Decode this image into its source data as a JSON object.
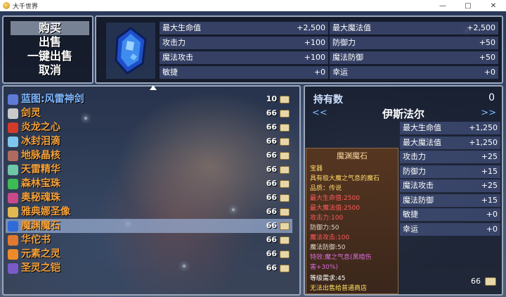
{
  "window": {
    "title": "大千世界",
    "controls": [
      "—",
      "□",
      "✕"
    ]
  },
  "commands": [
    "购买",
    "出售",
    "一键出售",
    "取消"
  ],
  "detail_stats": [
    {
      "label": "最大生命值",
      "value": "+2,500"
    },
    {
      "label": "最大魔法值",
      "value": "+2,500"
    },
    {
      "label": "攻击力",
      "value": "+100"
    },
    {
      "label": "防御力",
      "value": "+50"
    },
    {
      "label": "魔法攻击",
      "value": "+100"
    },
    {
      "label": "魔法防御",
      "value": "+50"
    },
    {
      "label": "敏捷",
      "value": "+0"
    },
    {
      "label": "幸运",
      "value": "+0"
    }
  ],
  "items": [
    {
      "name": "蓝图:风雷神剑",
      "count": "10",
      "color": "#5f7bd8",
      "text_color": "#7fb8ff"
    },
    {
      "name": "剑灵",
      "count": "66",
      "color": "#c9c9c9",
      "text_color": "#f5a13a"
    },
    {
      "name": "炎龙之心",
      "count": "66",
      "color": "#d23a2a",
      "text_color": "#f5a13a"
    },
    {
      "name": "冰封泪滴",
      "count": "66",
      "color": "#7ec6f0",
      "text_color": "#f5a13a"
    },
    {
      "name": "地脉晶核",
      "count": "66",
      "color": "#b06a60",
      "text_color": "#f5a13a"
    },
    {
      "name": "天雷精华",
      "count": "66",
      "color": "#6fc7a8",
      "text_color": "#f5a13a"
    },
    {
      "name": "森林宝珠",
      "count": "66",
      "color": "#3dbb55",
      "text_color": "#f5a13a"
    },
    {
      "name": "奥秘魂珠",
      "count": "66",
      "color": "#c94a8a",
      "text_color": "#f5a13a"
    },
    {
      "name": "雅典娜圣像",
      "count": "66",
      "color": "#e0b850",
      "text_color": "#f5a13a"
    },
    {
      "name": "魔渊魔石",
      "count": "66",
      "color": "#2f6bd8",
      "text_color": "#f5a13a"
    },
    {
      "name": "华佗书",
      "count": "66",
      "color": "#e07a30",
      "text_color": "#f5a13a"
    },
    {
      "name": "元素之灵",
      "count": "66",
      "color": "#ee8a2a",
      "text_color": "#f5a13a"
    },
    {
      "name": "圣灵之铠",
      "count": "66",
      "color": "#7a5ac8",
      "text_color": "#f5a13a"
    }
  ],
  "selected_index": 9,
  "side": {
    "owned_label": "持有数",
    "owned_value": "0",
    "prev": "<<",
    "next": ">>",
    "character": "伊斯法尔",
    "stats": [
      {
        "label": "最大生命值",
        "value": "+1,250"
      },
      {
        "label": "最大魔法值",
        "value": "+1,250"
      },
      {
        "label": "攻击力",
        "value": "+25"
      },
      {
        "label": "防御力",
        "value": "+15"
      },
      {
        "label": "魔法攻击",
        "value": "+25"
      },
      {
        "label": "魔法防御",
        "value": "+15"
      },
      {
        "label": "敏捷",
        "value": "+0"
      },
      {
        "label": "幸运",
        "value": "+0"
      }
    ],
    "price": "66"
  },
  "card": {
    "title": "魔渊魔石",
    "category": "宝器",
    "desc": "具有极大魔之气息的魔石",
    "quality": "品质：传说",
    "lines": [
      {
        "text": "最大生命值:2500",
        "color": "#ff5a5a"
      },
      {
        "text": "最大魔法值:2500",
        "color": "#ff5a5a"
      },
      {
        "text": "攻击力:100",
        "color": "#ff5a5a"
      },
      {
        "text": "防御力:50",
        "color": "#e0d6c8"
      },
      {
        "text": "魔法攻击:100",
        "color": "#ff5a5a"
      },
      {
        "text": "魔法防御:50",
        "color": "#e0d6c8"
      },
      {
        "text": "特效:魔之气息(黑暗伤",
        "color": "#d86cd8"
      },
      {
        "text": "害+30%)",
        "color": "#d86cd8"
      }
    ],
    "level_req": "等级需求:45",
    "note": "无法出售给普通商店"
  }
}
